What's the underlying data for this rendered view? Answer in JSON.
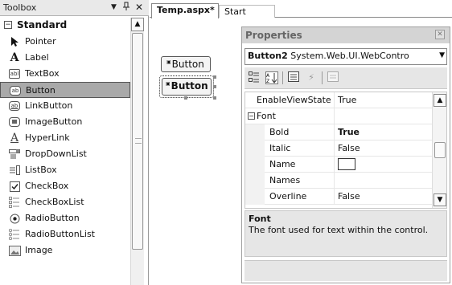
{
  "toolbox": {
    "title": "Toolbox",
    "controls": {
      "dropdown": "▼",
      "pin": "1",
      "close": "✕"
    },
    "section": {
      "toggle": "−",
      "label": "Standard"
    },
    "items": [
      {
        "label": "Pointer",
        "icon": "pointer-icon"
      },
      {
        "label": "Label",
        "icon": "label-icon"
      },
      {
        "label": "TextBox",
        "icon": "textbox-icon"
      },
      {
        "label": "Button",
        "icon": "button-icon",
        "selected": true
      },
      {
        "label": "LinkButton",
        "icon": "linkbutton-icon"
      },
      {
        "label": "ImageButton",
        "icon": "imagebutton-icon"
      },
      {
        "label": "HyperLink",
        "icon": "hyperlink-icon"
      },
      {
        "label": "DropDownList",
        "icon": "dropdownlist-icon"
      },
      {
        "label": "ListBox",
        "icon": "listbox-icon"
      },
      {
        "label": "CheckBox",
        "icon": "checkbox-icon"
      },
      {
        "label": "CheckBoxList",
        "icon": "checkboxlist-icon"
      },
      {
        "label": "RadioButton",
        "icon": "radiobutton-icon"
      },
      {
        "label": "RadioButtonList",
        "icon": "radiobuttonlist-icon"
      },
      {
        "label": "Image",
        "icon": "image-icon"
      }
    ]
  },
  "tabs": [
    {
      "label": "Temp.aspx*",
      "active": true
    },
    {
      "label": "Start Page",
      "active": false
    }
  ],
  "design": {
    "button1": "Button",
    "button2": "Button"
  },
  "properties": {
    "title": "Properties",
    "object_name": "Button2",
    "object_type": "System.Web.UI.WebContro",
    "rows": [
      {
        "name": "EnableViewState",
        "value": "True"
      },
      {
        "name": "Font",
        "value": "",
        "category": true
      },
      {
        "name": "Bold",
        "value": "True",
        "bold_value": true
      },
      {
        "name": "Italic",
        "value": "False"
      },
      {
        "name": "Name",
        "value": ""
      },
      {
        "name": "Names",
        "value": ""
      },
      {
        "name": "Overline",
        "value": "False"
      }
    ],
    "description": {
      "title": "Font",
      "text": "The font used for text within the control."
    }
  }
}
